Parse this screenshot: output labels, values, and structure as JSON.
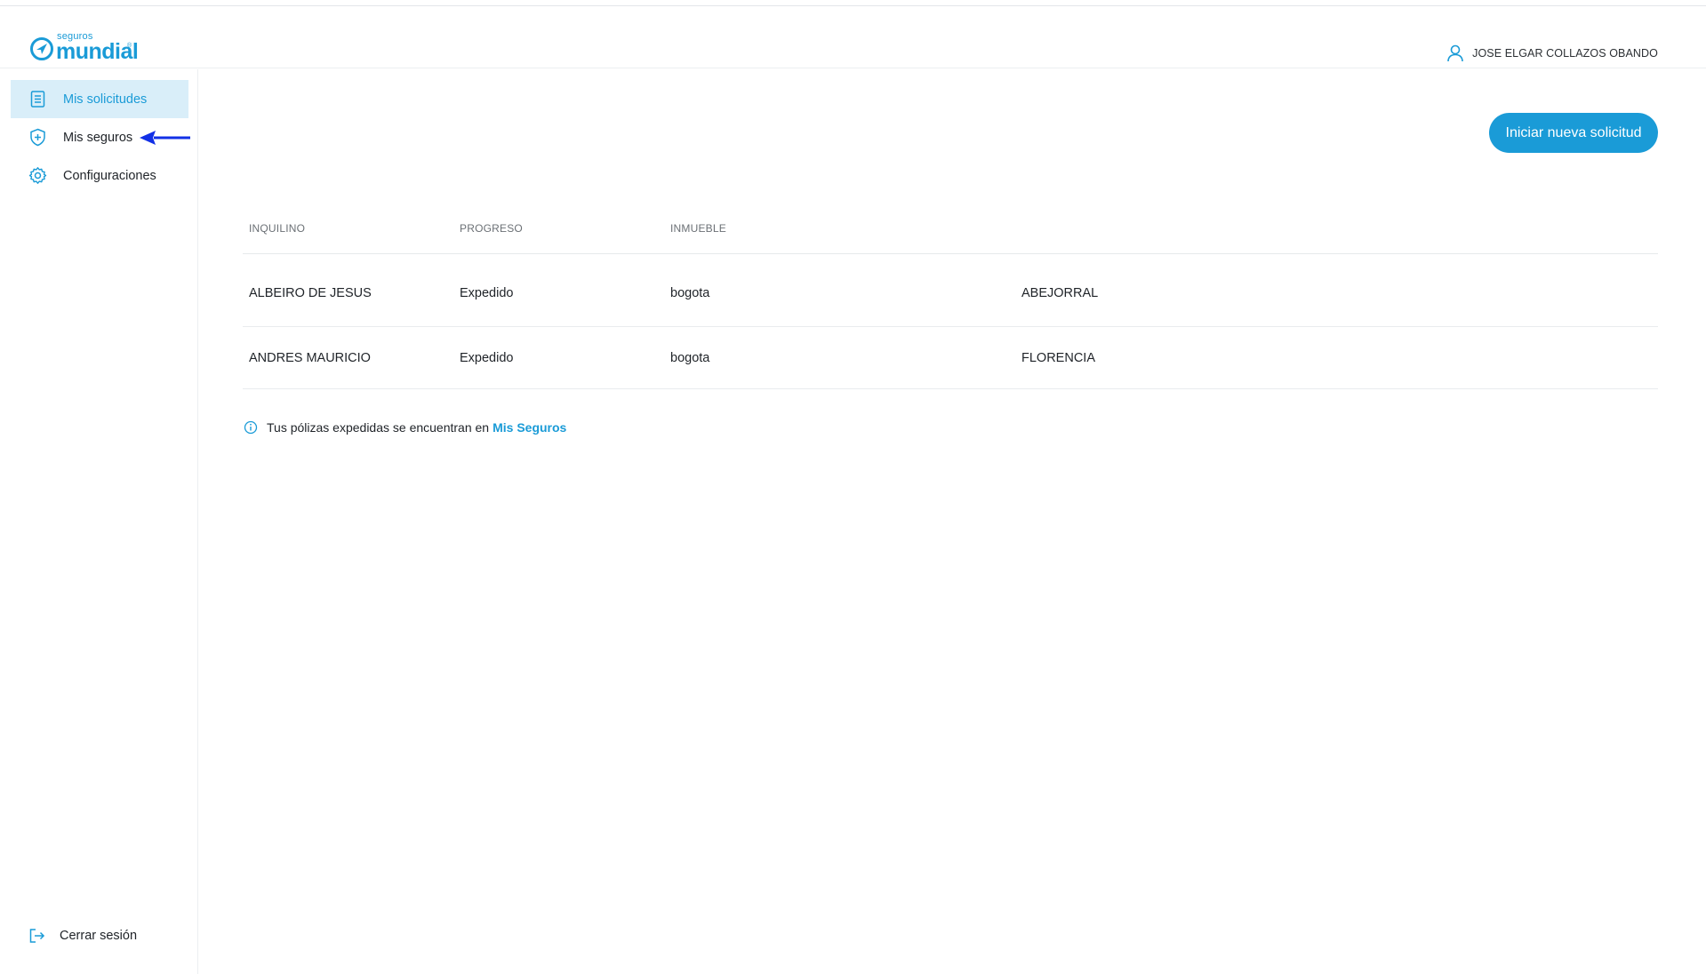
{
  "brand": {
    "small": "seguros",
    "name": "mundial",
    "registered": "®",
    "accent_color": "#1a9bd7"
  },
  "header": {
    "user_name": "JOSE ELGAR COLLAZOS OBANDO"
  },
  "sidebar": {
    "items": [
      {
        "label": "Mis solicitudes",
        "icon": "document-icon",
        "active": true
      },
      {
        "label": "Mis seguros",
        "icon": "shield-plus-icon",
        "active": false
      },
      {
        "label": "Configuraciones",
        "icon": "gear-icon",
        "active": false
      }
    ],
    "logout_label": "Cerrar sesión"
  },
  "main": {
    "new_request_button": "Iniciar nueva solicitud",
    "table": {
      "columns": [
        "INQUILINO",
        "PROGRESO",
        "INMUEBLE"
      ],
      "rows": [
        {
          "inquilino": "ALBEIRO DE JESUS",
          "progreso": "Expedido",
          "inmueble": "bogota",
          "ciudad": "ABEJORRAL"
        },
        {
          "inquilino": "ANDRES MAURICIO",
          "progreso": "Expedido",
          "inmueble": "bogota",
          "ciudad": "FLORENCIA"
        }
      ]
    },
    "info": {
      "text": "Tus pólizas expedidas se encuentran en",
      "link": "Mis Seguros"
    }
  },
  "annotation_arrow_color": "#1230e6"
}
